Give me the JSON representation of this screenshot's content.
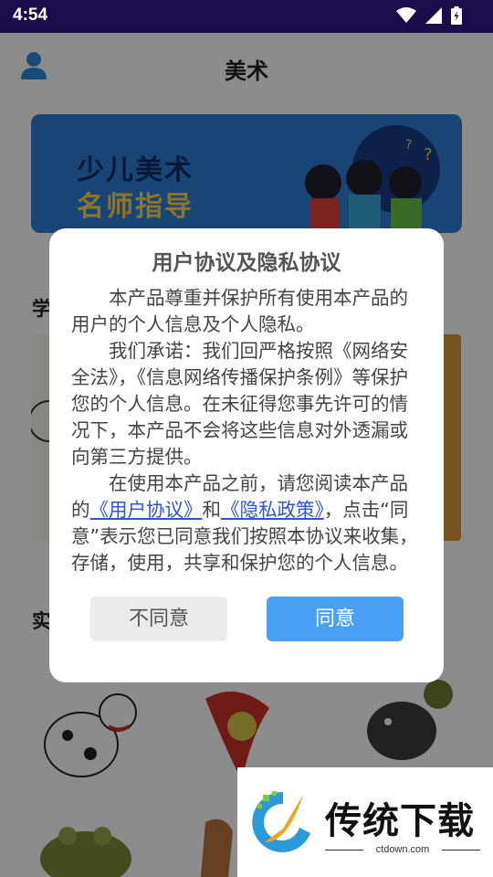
{
  "status_bar": {
    "time": "4:54"
  },
  "app_bar": {
    "title": "美术"
  },
  "banner": {
    "line1": "少儿美术",
    "line2": "名师指导"
  },
  "sections": {
    "learn_peek": "学",
    "practice_peek": "实"
  },
  "dialog": {
    "title": "用户协议及隐私协议",
    "para1": "本产品尊重并保护所有使用本产品的用户的个人信息及个人隐私。",
    "para2": "我们承诺：我们回严格按照《网络安全法》，《信息网络传播保护条例》等保护您的个人信息。在未征得您事先许可的情况下，本产品不会将这些信息对外透漏或向第三方提供。",
    "para3_prefix": "在使用本产品之前，请您阅读本产品的",
    "user_agreement_link": "《用户协议》",
    "para3_and": "和",
    "privacy_policy_link": "《隐私政策》",
    "para3_suffix": "，点击“同意”表示您已同意我们按照本协议来收集，存储，使用，共享和保护您的个人信息。",
    "disagree_label": "不同意",
    "agree_label": "同意"
  },
  "watermark": {
    "brand": "传统下载",
    "url": "ctdown.com"
  },
  "colors": {
    "status_bar": "#1b0c4a",
    "agree_button": "#4aa0f5",
    "link": "#2f55d4",
    "banner": "#2d7fd8"
  }
}
